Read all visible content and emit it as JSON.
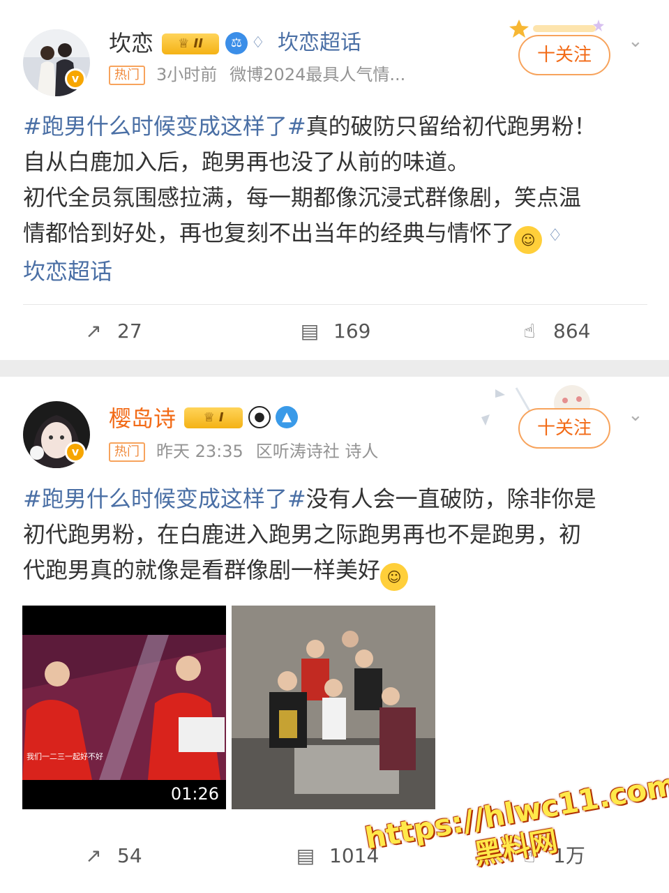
{
  "posts": [
    {
      "username": "坎恋",
      "vip_level": "II",
      "chaohua_label": "坎恋超话",
      "hot_badge": "热门",
      "time": "3小时前",
      "source": "微博2024最具人气情...",
      "follow_label": "十关注",
      "hashtag": "#跑男什么时候变成这样了#",
      "text_parts": [
        "真的破防只留给初代跑男粉！",
        "自从白鹿加入后，跑男再也没了从前的味道。",
        "初代全员氛围感拉满，每一期都像沉浸式群像剧，笑点温",
        "情都恰到好处，再也复刻不出当年的经典与情怀了"
      ],
      "tail_link": "坎恋超话",
      "reposts": "27",
      "comments": "169",
      "likes": "864"
    },
    {
      "username": "樱岛诗",
      "vip_level": "I",
      "hot_badge": "热门",
      "time": "昨天 23:35",
      "source": "区听涛诗社 诗人",
      "follow_label": "十关注",
      "hashtag": "#跑男什么时候变成这样了#",
      "text_parts": [
        "没有人会一直破防，除非你是",
        "初代跑男粉，在白鹿进入跑男之际跑男再也不是跑男，初",
        "代跑男真的就像是看群像剧一样美好"
      ],
      "video_duration": "01:26",
      "video_subtitle": "我们一二三一起好不好",
      "reposts": "54",
      "comments": "1014",
      "likes": "1万"
    }
  ],
  "watermark": {
    "url": "https://hlwc11.com",
    "name": "黑料网"
  },
  "colors": {
    "link_blue": "#4a6fa5",
    "accent_orange": "#f26a16",
    "gold": "#f4b215"
  }
}
